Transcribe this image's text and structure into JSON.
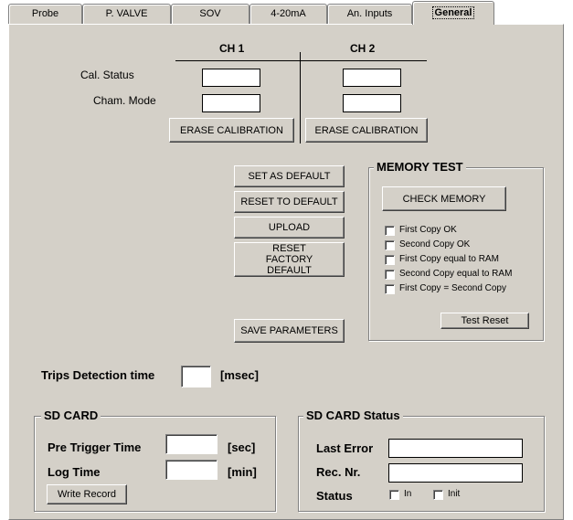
{
  "tabs": [
    "Probe",
    "P. VALVE",
    "SOV",
    "4-20mA",
    "An. Inputs",
    "General"
  ],
  "active_tab": "General",
  "channels": {
    "ch1_header": "CH 1",
    "ch2_header": "CH 2",
    "cal_status_label": "Cal. Status",
    "cham_mode_label": "Cham. Mode",
    "ch1_cal_status": "",
    "ch1_cham_mode": "",
    "ch2_cal_status": "",
    "ch2_cham_mode": "",
    "erase_ch1": "ERASE CALIBRATION",
    "erase_ch2": "ERASE CALIBRATION"
  },
  "actions": {
    "set_default": "SET AS DEFAULT",
    "reset_default": "RESET TO DEFAULT",
    "upload": "UPLOAD",
    "reset_factory": "RESET FACTORY DEFAULT",
    "save_params": "SAVE PARAMETERS"
  },
  "memory_test": {
    "title": "MEMORY TEST",
    "check_button": "CHECK MEMORY",
    "checks": [
      {
        "label": "First Copy OK",
        "checked": false
      },
      {
        "label": "Second Copy OK",
        "checked": false
      },
      {
        "label": "First Copy equal to RAM",
        "checked": false
      },
      {
        "label": "Second Copy equal to RAM",
        "checked": false
      },
      {
        "label": "First Copy = Second Copy",
        "checked": false
      }
    ],
    "reset_button": "Test  Reset"
  },
  "trips": {
    "label": "Trips Detection time",
    "value": "",
    "unit": "[msec]"
  },
  "sd_card": {
    "title": "SD CARD",
    "pre_trigger_label": "Pre Trigger Time",
    "pre_trigger_value": "",
    "pre_trigger_unit": "[sec]",
    "log_time_label": "Log Time",
    "log_time_value": "",
    "log_time_unit": "[min]",
    "write_button": "Write Record"
  },
  "sd_status": {
    "title": "SD CARD Status",
    "last_error_label": "Last Error",
    "last_error_value": "",
    "rec_nr_label": "Rec. Nr.",
    "rec_nr_value": "",
    "status_label": "Status",
    "in_label": "In",
    "init_label": "Init"
  }
}
